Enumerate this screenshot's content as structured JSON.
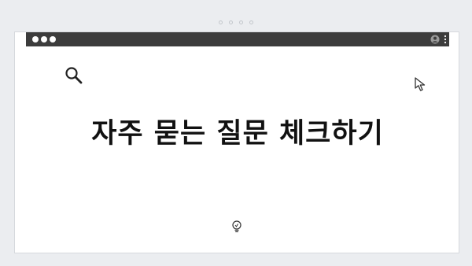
{
  "pager": {
    "dots": 4
  },
  "window": {
    "titlebar": {
      "color": "#3c3c3c",
      "controls": [
        "circle",
        "circle",
        "circle"
      ],
      "icons": [
        "user-icon",
        "more-vertical-icon"
      ]
    }
  },
  "content": {
    "headline": "자주 묻는 질문 체크하기",
    "icons": [
      "search-icon",
      "cursor-icon",
      "lightbulb-icon"
    ]
  },
  "colors": {
    "background": "#ebedf0",
    "card": "#ffffff",
    "text": "#111111"
  }
}
